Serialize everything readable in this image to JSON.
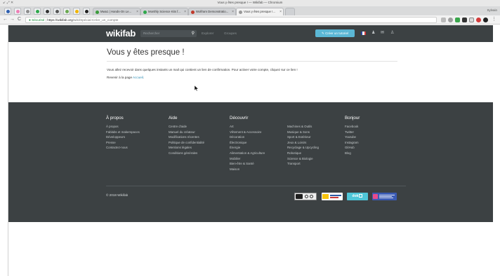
{
  "browser": {
    "window_title": "Vous y êtes presque ! — Wikifab — Chromium",
    "window_controls": "↙ ⤢ ✕",
    "profile_name": "Sylvain",
    "tabs": [
      {
        "label": "Mwa1 | Hands-On Le...",
        "favicon_color": "#3c9c3c"
      },
      {
        "label": "Monthly Science Kits f...",
        "favicon_color": "#2ea84b"
      },
      {
        "label": "Wolfram Demonstratio...",
        "favicon_color": "#c0392b"
      },
      {
        "label": "Vous y êtes presque !...",
        "favicon_color": "#999999"
      }
    ],
    "address": {
      "secure_label": "Sécurisé",
      "separator": "|",
      "host": "https://wikifab.org",
      "path": "/wiki/Spécial:Créer_un_compte"
    },
    "nav_back": "←",
    "nav_forward": "→",
    "nav_reload": "C"
  },
  "site": {
    "logo": "wikifab",
    "search_placeholder": "Rechercher",
    "search_icon": "magnifier-icon",
    "nav": {
      "explore": "Explorer",
      "groups": "Groupes"
    },
    "create_tutorial": "✎ Créer un tutoriel",
    "flag_colors": [
      "#2b4aa0",
      "#ffffff",
      "#d33a3a"
    ]
  },
  "content": {
    "title": "Vous y êtes presque !",
    "message": "Vous allez recevoir dans quelques instants un mail qui contient un lien de confirmation. Pour activer votre compte, cliquez sur ce lien !",
    "back_prefix": "Revenir à la page",
    "back_link": "Accueil",
    "back_suffix": "."
  },
  "footer": {
    "columns": [
      {
        "heading": "À propos",
        "items": [
          "À propos",
          "Fablabs et makerspaces",
          "Développeurs",
          "Presse",
          "Contactez-nous"
        ]
      },
      {
        "heading": "Aide",
        "items": [
          "Centre d'aide",
          "Manuel du créateur",
          "Modifications récentes",
          "Politique de confidentialité",
          "Mentions légales",
          "Conditions générales"
        ]
      },
      {
        "heading": "Découvrir",
        "items": [
          "Art",
          "Vêtement & Accessoire",
          "Décoration",
          "Électronique",
          "Énergie",
          "Alimentation & Agriculture",
          "Mobilier",
          "Bien-être & Santé",
          "Maison"
        ]
      },
      {
        "heading": "",
        "items": [
          "Machines & Outils",
          "Musique & Sons",
          "Sport & Extérieur",
          "Jeux & Loisirs",
          "Recyclage & Upcycling",
          "Robotique",
          "Science & Biologie",
          "Transport"
        ]
      },
      {
        "heading": "Bonjour",
        "items": [
          "Facebook",
          "Twitter",
          "Youtube",
          "Instagram",
          "GitHub",
          "Blog"
        ]
      }
    ],
    "copyright": "© 2018 Wikifab",
    "badge_dok": "dok"
  }
}
